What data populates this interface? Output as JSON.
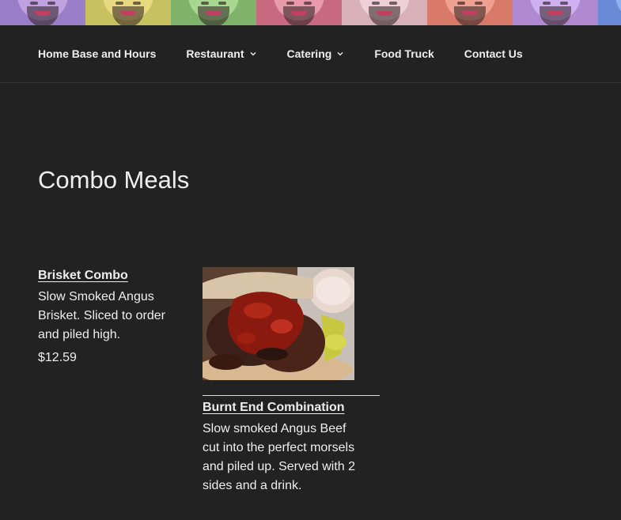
{
  "banner": {
    "tile_colors": [
      "#9a7fc8",
      "#c9c060",
      "#7fb26a",
      "#c86a7f",
      "#d8b0b8",
      "#d87a6a",
      "#b08ad0",
      "#6a8ad8"
    ],
    "face_colors": [
      "#c0a0e0",
      "#e8d880",
      "#a8d890",
      "#e89aa8",
      "#f0d0d8",
      "#f0a090",
      "#d0b0f0",
      "#90b0f0"
    ]
  },
  "nav": {
    "items": [
      {
        "label": "Home Base and Hours",
        "has_dropdown": false
      },
      {
        "label": "Restaurant",
        "has_dropdown": true
      },
      {
        "label": "Catering",
        "has_dropdown": true
      },
      {
        "label": "Food Truck",
        "has_dropdown": false
      },
      {
        "label": "Contact Us",
        "has_dropdown": false
      }
    ]
  },
  "page": {
    "title": "Combo Meals"
  },
  "menu": {
    "items": [
      {
        "name": "Brisket Combo",
        "description": "Slow Smoked Angus Brisket. Sliced to order and piled high.",
        "price": "$12.59"
      },
      {
        "name": "Burnt End Combination",
        "description": "Slow smoked Angus Beef cut into the perfect morsels and piled up. Served with 2 sides and a drink.",
        "image": "burnt-ends-sandwich-photo"
      }
    ]
  }
}
